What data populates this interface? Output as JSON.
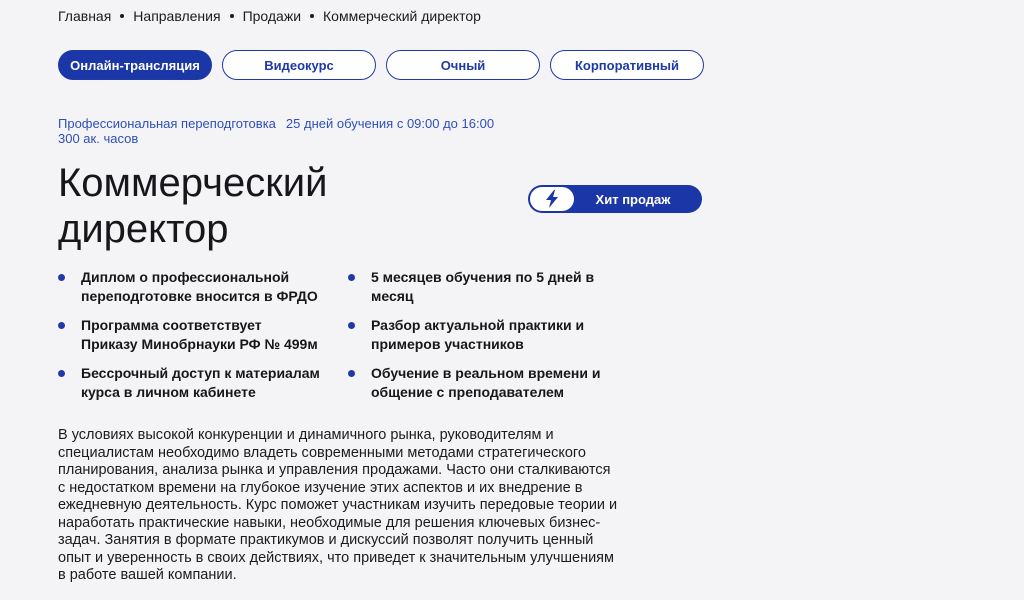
{
  "breadcrumb": {
    "items": [
      "Главная",
      "Направления",
      "Продажи",
      "Коммерческий директор"
    ]
  },
  "tabs": [
    {
      "label": "Онлайн-трансляция",
      "active": true
    },
    {
      "label": "Видеокурс",
      "active": false
    },
    {
      "label": "Очный",
      "active": false
    },
    {
      "label": "Корпоративный",
      "active": false
    }
  ],
  "meta": {
    "program_type": "Профессиональная переподготовка",
    "schedule": "25 дней обучения с 09:00 до 16:00",
    "hours": "300 ак. часов"
  },
  "course": {
    "title": "Коммерческий директор"
  },
  "badge": {
    "label": "Хит продаж",
    "icon": "lightning-icon"
  },
  "features": [
    "Диплом о профессиональной переподготовке вносится в ФРДО",
    "5 месяцев обучения по 5 дней в месяц",
    "Программа соответствует Приказу Минобрнауки РФ № 499м",
    "Разбор актуальной практики и примеров участников",
    "Бессрочный доступ к материалам курса в личном кабинете",
    "Обучение в реальном времени и общение с преподавателем"
  ],
  "description": "В условиях высокой конкуренции и динамичного рынка, руководителям и специалистам необходимо владеть современными методами стратегического планирования, анализа рынка и управления продажами. Часто они сталкиваются с недостатком времени на глубокое изучение этих аспектов и их внедрение в ежедневную деятельность. Курс поможет участникам изучить передовые теории и наработать практические навыки, необходимые для решения ключевых бизнес-задач. Занятия в формате практикумов и дискуссий позволят получить ценный опыт и уверенность в своих действиях, что приведет к значительным улучшениям в работе вашей компании.",
  "colors": {
    "accent": "#1b36a6",
    "meta_text": "#2f4fb8",
    "background": "#f4f4f6"
  }
}
